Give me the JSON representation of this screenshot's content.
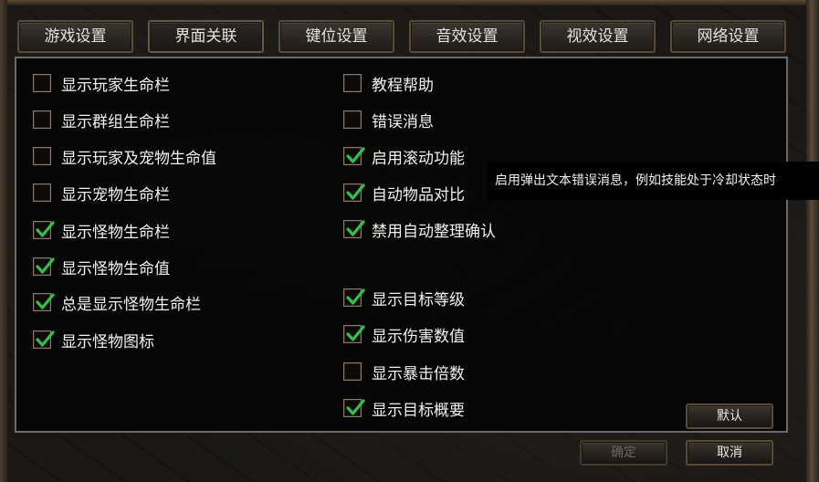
{
  "tabs": [
    {
      "label": "游戏设置"
    },
    {
      "label": "界面关联"
    },
    {
      "label": "键位设置"
    },
    {
      "label": "音效设置"
    },
    {
      "label": "视效设置"
    },
    {
      "label": "网络设置"
    }
  ],
  "left_options": [
    {
      "label": "显示玩家生命栏",
      "checked": false
    },
    {
      "label": "显示群组生命栏",
      "checked": false
    },
    {
      "label": "显示玩家及宠物生命值",
      "checked": false
    },
    {
      "label": "显示宠物生命栏",
      "checked": false
    },
    {
      "label": "显示怪物生命栏",
      "checked": true
    },
    {
      "label": "显示怪物生命值",
      "checked": true
    },
    {
      "label": "总是显示怪物生命栏",
      "checked": true
    },
    {
      "label": "显示怪物图标",
      "checked": true
    }
  ],
  "right_options_top": [
    {
      "label": "教程帮助",
      "checked": false
    },
    {
      "label": "错误消息",
      "checked": false
    },
    {
      "label": "启用滚动功能",
      "checked": true
    },
    {
      "label": "自动物品对比",
      "checked": true
    },
    {
      "label": "禁用自动整理确认",
      "checked": true
    }
  ],
  "right_options_bottom": [
    {
      "label": "显示目标等级",
      "checked": true
    },
    {
      "label": "显示伤害数值",
      "checked": true
    },
    {
      "label": "显示暴击倍数",
      "checked": false
    },
    {
      "label": "显示目标概要",
      "checked": true
    }
  ],
  "tooltip": {
    "text": "启用弹出文本错误消息，例如技能处于冷却状态时"
  },
  "buttons": {
    "default_label": "默认",
    "ok_label": "确定",
    "cancel_label": "取消"
  },
  "colors": {
    "check": "#2fc24a",
    "text": "#f2f0ec",
    "panel_border": "#6a6a6a"
  }
}
